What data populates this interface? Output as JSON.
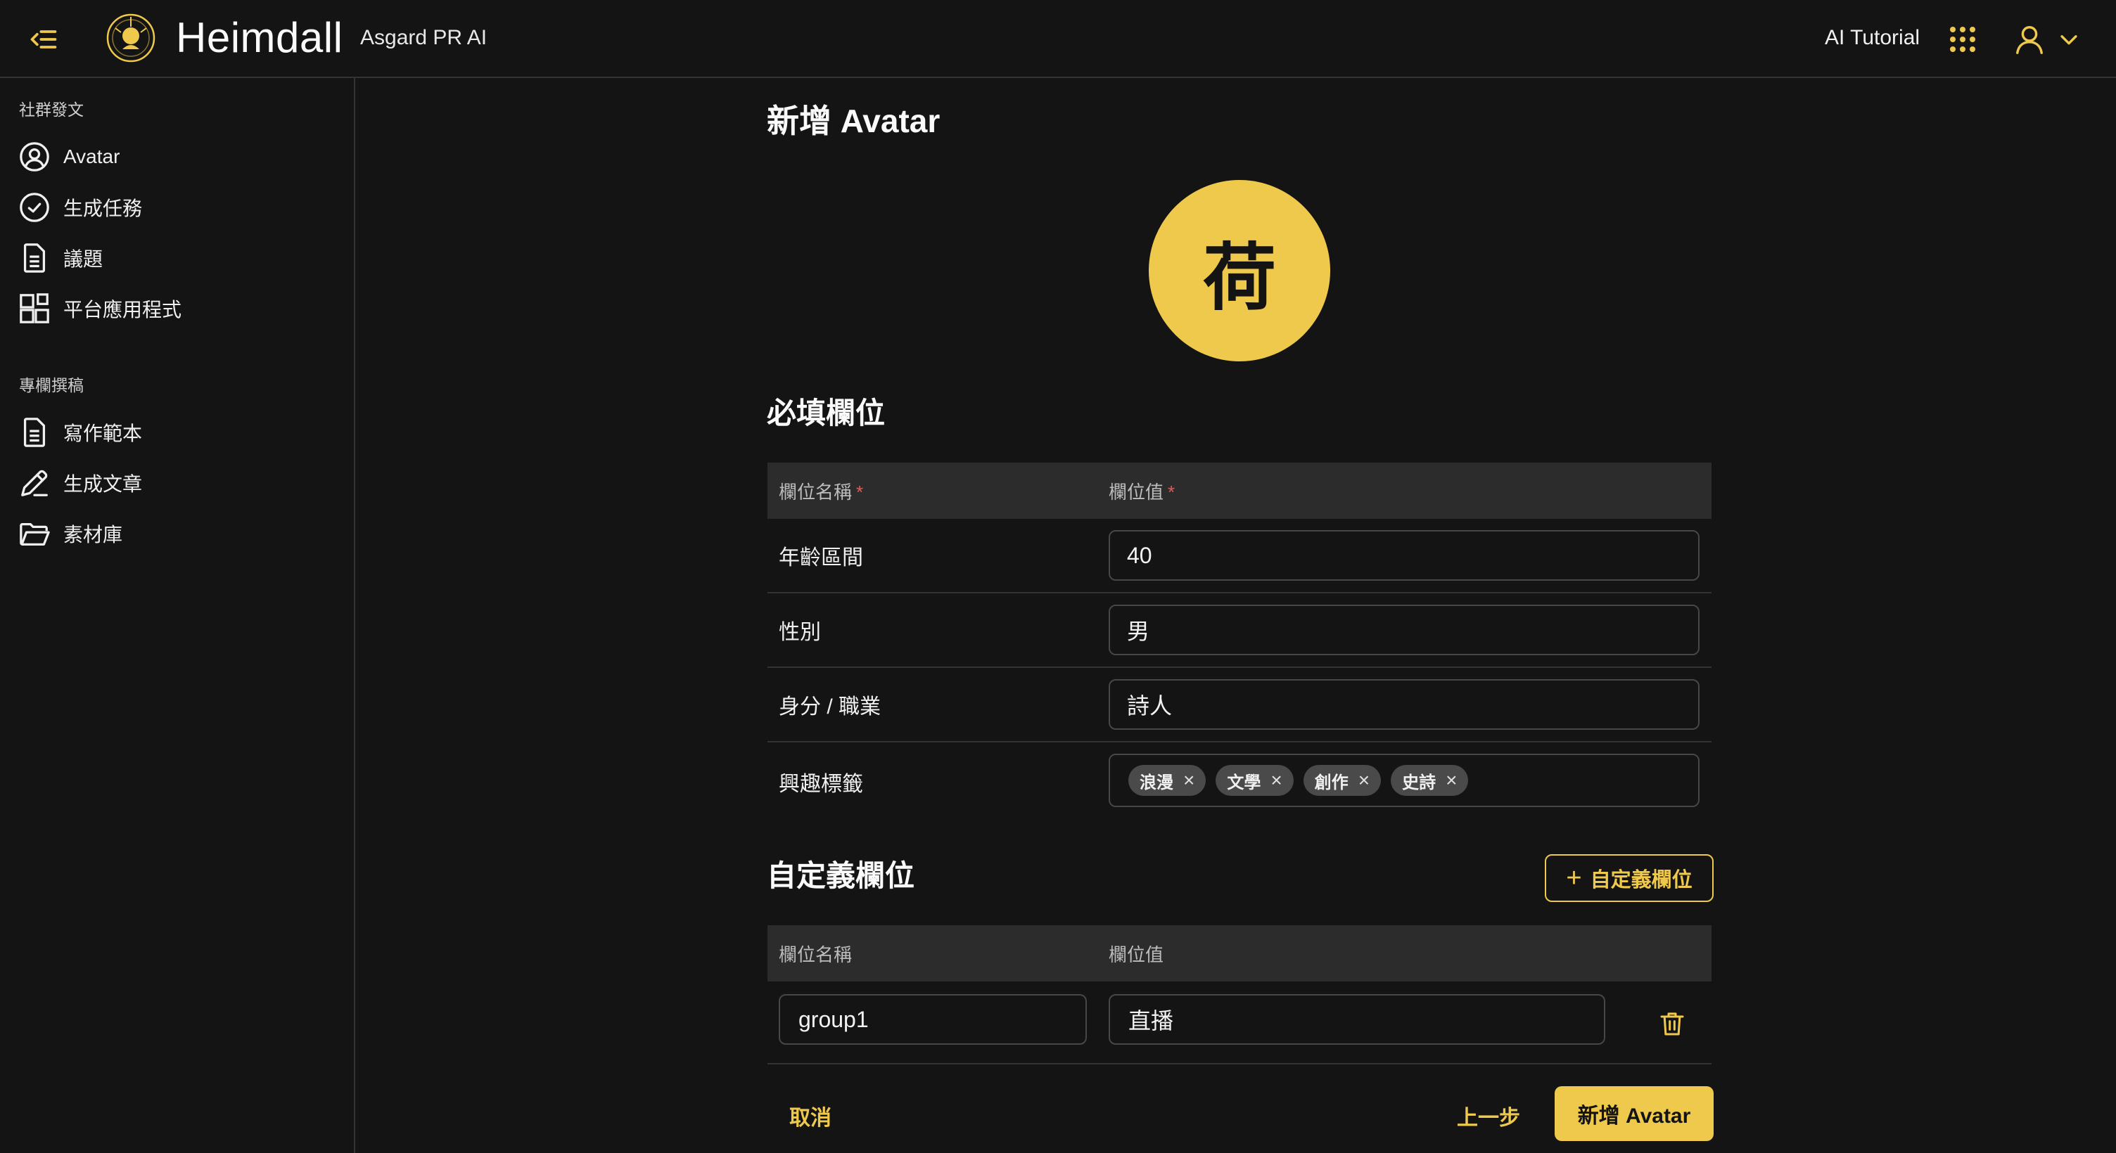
{
  "header": {
    "brand_name": "Heimdall",
    "brand_sub": "Asgard PR AI",
    "tutorial_label": "AI Tutorial"
  },
  "sidebar": {
    "sections": [
      {
        "title": "社群發文",
        "items": [
          {
            "label": "Avatar",
            "icon": "user-circle-icon"
          },
          {
            "label": "生成任務",
            "icon": "check-circle-icon"
          },
          {
            "label": "議題",
            "icon": "document-icon"
          },
          {
            "label": "平台應用程式",
            "icon": "apps-grid-icon"
          }
        ]
      },
      {
        "title": "專欄撰稿",
        "items": [
          {
            "label": "寫作範本",
            "icon": "document-icon"
          },
          {
            "label": "生成文章",
            "icon": "pen-icon"
          },
          {
            "label": "素材庫",
            "icon": "folder-icon"
          }
        ]
      }
    ]
  },
  "main": {
    "title": "新增 Avatar",
    "avatar_char": "荷",
    "required": {
      "title": "必填欄位",
      "col_name": "欄位名稱",
      "col_value": "欄位值",
      "rows": [
        {
          "label": "年齡區間",
          "value": "40"
        },
        {
          "label": "性別",
          "value": "男"
        },
        {
          "label": "身分 / 職業",
          "value": "詩人"
        }
      ],
      "tags_label": "興趣標籤",
      "tags": [
        "浪漫",
        "文學",
        "創作",
        "史詩"
      ]
    },
    "custom": {
      "title": "自定義欄位",
      "add_label": "自定義欄位",
      "col_name": "欄位名稱",
      "col_value": "欄位值",
      "rows": [
        {
          "name": "group1",
          "value": "直播"
        }
      ]
    },
    "footer": {
      "cancel": "取消",
      "prev": "上一步",
      "submit": "新增 Avatar"
    }
  },
  "colors": {
    "accent": "#efc94c",
    "background": "#141414",
    "required_mark": "#e05a5a"
  }
}
